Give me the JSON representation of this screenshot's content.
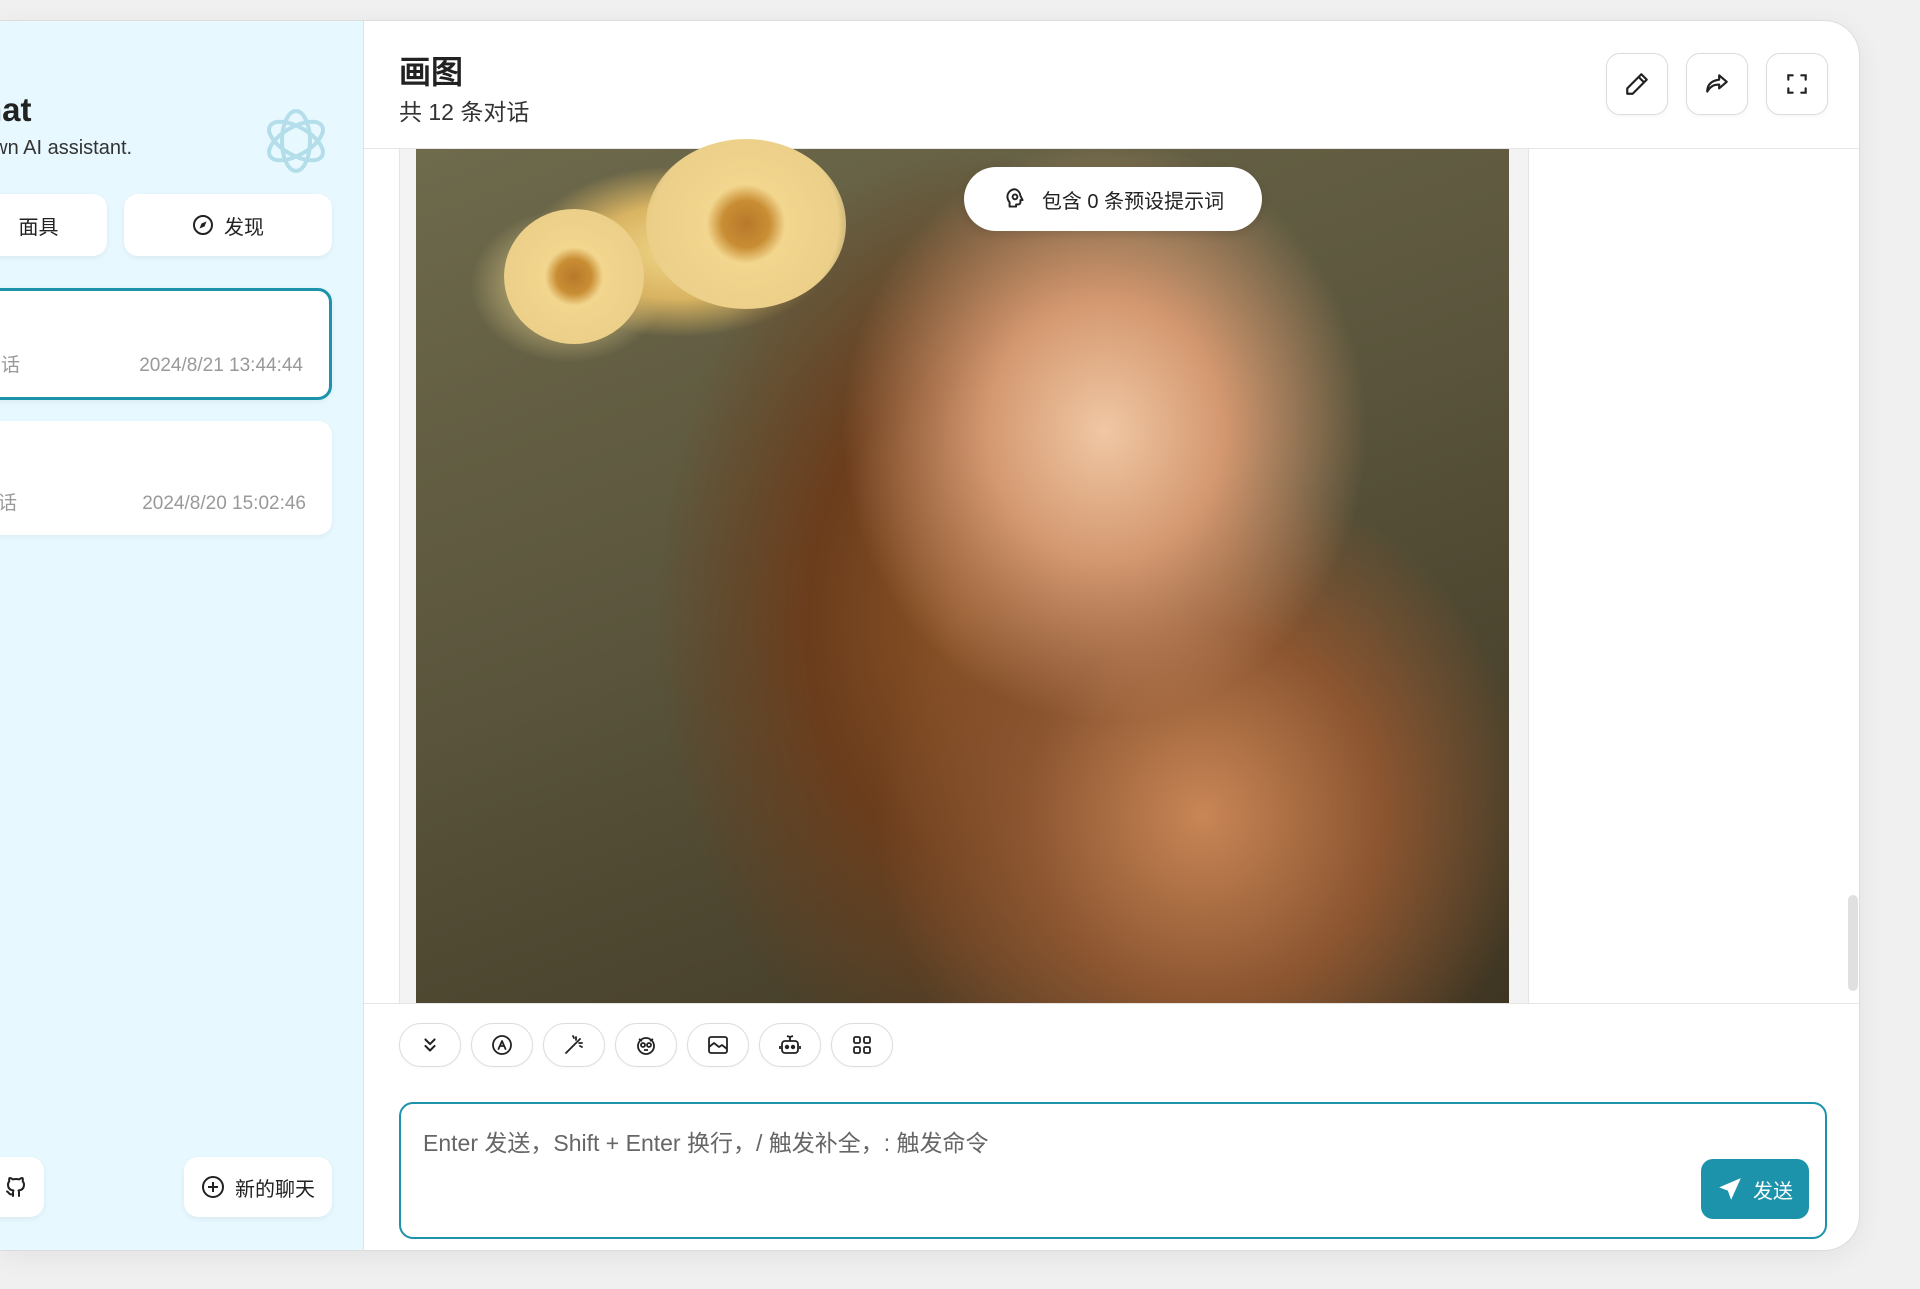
{
  "sidebar": {
    "title": "hat",
    "subtitle": "own AI assistant.",
    "mask_label": "面具",
    "discover_label": "发现",
    "chats": [
      {
        "count_label": "话",
        "time": "2024/8/21 13:44:44",
        "selected": true
      },
      {
        "count_label": "话",
        "time": "2024/8/20 15:02:46",
        "selected": false
      }
    ],
    "new_chat_label": "新的聊天"
  },
  "header": {
    "title": "画图",
    "subtitle": "共 12 条对话"
  },
  "chat": {
    "prompt_badge": "包含 0 条预设提示词"
  },
  "input": {
    "placeholder": "Enter 发送，Shift + Enter 换行，/ 触发补全，: 触发命令",
    "send_label": "发送"
  },
  "colors": {
    "accent": "#1d93ab",
    "sidebar_bg": "#e7f8ff"
  },
  "icons": {
    "toolbar": [
      "chevrons-down-icon",
      "text-a-icon",
      "magic-wand-icon",
      "mask-icon",
      "image-icon",
      "robot-icon",
      "grid-icon"
    ],
    "header": [
      "pencil-icon",
      "share-icon",
      "fullscreen-icon"
    ]
  }
}
